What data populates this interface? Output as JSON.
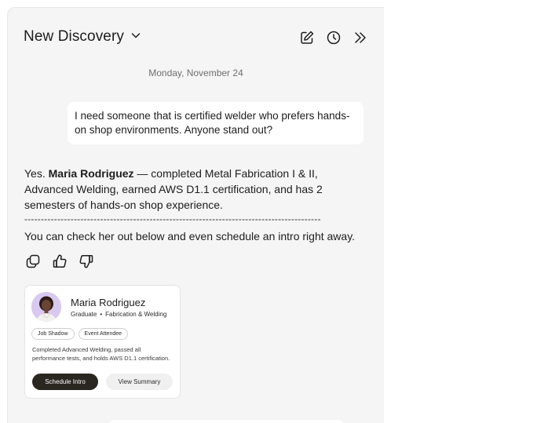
{
  "header": {
    "title": "New Discovery",
    "icons": [
      "chevron-down-icon",
      "edit-icon",
      "history-icon",
      "collapse-icon"
    ]
  },
  "chat": {
    "date": "Monday, November 24",
    "user_message": "I need someone that is certified welder who prefers hands-on shop environments. Anyone stand out?",
    "reply": {
      "p1": "Yes.",
      "name": "Maria Rodriguez",
      "p2": "— completed",
      "courses": "Metal Fabrication I & II, Advanced Welding",
      "p3": ", earned",
      "cert": "AWS D1.1 certification",
      "p4": ", and has 2 semesters of hands-on shop experience."
    },
    "divider": "------------------------------------------------------------------------------------------",
    "followup": "You can check her out below and even schedule an intro right away."
  },
  "feedback": {
    "icons": [
      "copy-icon",
      "thumbs-up-icon",
      "thumbs-down-icon"
    ]
  },
  "candidate": {
    "name": "Maria Rodriguez",
    "status": "Graduate",
    "program": "Fabrication & Welding",
    "tags": [
      "Job Shadow",
      "Event Attendee"
    ],
    "summary": "Completed Advanced Welding, passed all performance tests, and holds AWS D1.1 certification.",
    "primary_button": "Schedule Intro",
    "secondary_button": "View Summary"
  },
  "colors": {
    "panel_bg": "#f5f5f5",
    "primary_button_bg": "#2a2620",
    "avatar_bg": "#d9c8ef"
  }
}
